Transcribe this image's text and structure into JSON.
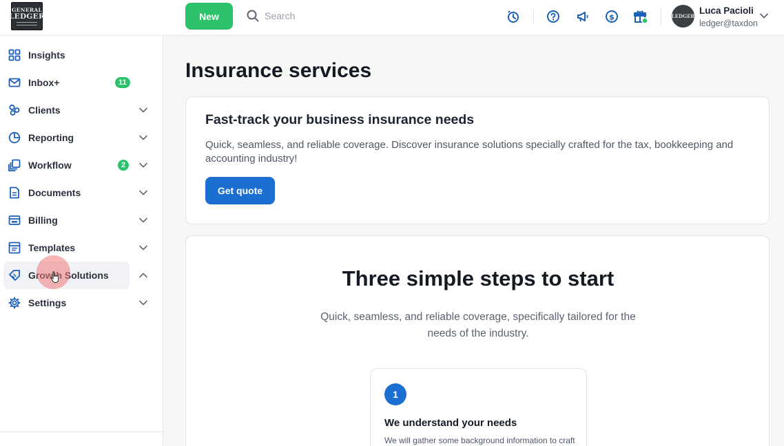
{
  "brand": {
    "logo_line1": "GENERAL",
    "logo_line2": "LEDGER"
  },
  "topbar": {
    "new_label": "New",
    "search_placeholder": "Search",
    "user_name": "Luca Pacioli",
    "user_email": "ledger@taxdon"
  },
  "sidebar": {
    "items": [
      {
        "label": "Insights",
        "icon": "grid-icon"
      },
      {
        "label": "Inbox+",
        "icon": "mail-icon",
        "badge": "11"
      },
      {
        "label": "Clients",
        "icon": "clients-icon"
      },
      {
        "label": "Reporting",
        "icon": "pie-chart-icon"
      },
      {
        "label": "Workflow",
        "icon": "workflow-icon",
        "badge": "2"
      },
      {
        "label": "Documents",
        "icon": "document-icon"
      },
      {
        "label": "Billing",
        "icon": "billing-icon"
      },
      {
        "label": "Templates",
        "icon": "template-icon"
      },
      {
        "label": "Growth Solutions",
        "icon": "growth-icon",
        "expanded": true
      },
      {
        "label": "Settings",
        "icon": "gear-icon"
      }
    ]
  },
  "main": {
    "title": "Insurance services",
    "promo": {
      "heading": "Fast-track your business insurance needs",
      "description": "Quick, seamless, and reliable coverage. Discover insurance solutions specially crafted for the tax, bookkeeping and accounting industry!",
      "button_label": "Get quote"
    },
    "steps_section": {
      "heading": "Three simple steps to start",
      "subtitle": "Quick, seamless, and reliable coverage, specifically tailored for the needs of the industry.",
      "steps": [
        {
          "number": "1",
          "title": "We understand your needs",
          "description": "We will gather some background information to craft"
        }
      ]
    }
  },
  "colors": {
    "accent_green": "#2bc26b",
    "accent_blue": "#1b6fd1"
  }
}
